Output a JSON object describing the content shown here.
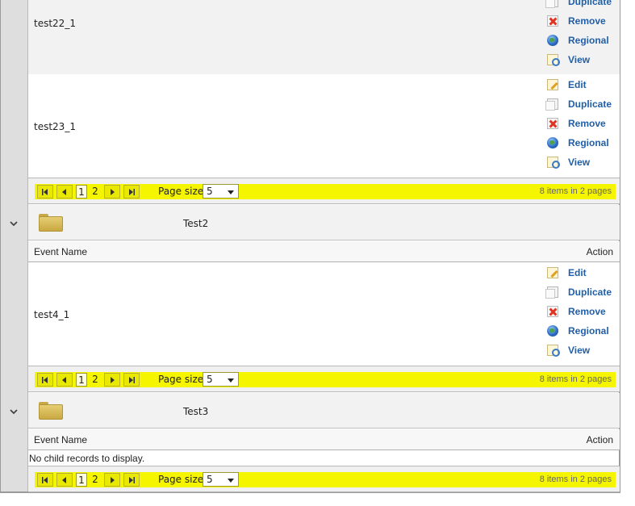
{
  "groups": [
    {
      "rows": [
        {
          "name": "test22_1",
          "actions": [
            "Duplicate",
            "Remove",
            "Regional",
            "View"
          ]
        },
        {
          "name": "test23_1",
          "actions": [
            "Edit",
            "Duplicate",
            "Remove",
            "Regional",
            "View"
          ]
        }
      ],
      "pager": {
        "pages": [
          "1",
          "2"
        ],
        "current": "1",
        "page_size_label": "Page size:",
        "page_size": "5",
        "info": "8 items in 2 pages"
      }
    },
    {
      "name": "Test2",
      "columns": {
        "event_name": "Event Name",
        "action": "Action"
      },
      "rows": [
        {
          "name": "test4_1",
          "actions": [
            "Edit",
            "Duplicate",
            "Remove",
            "Regional",
            "View"
          ]
        }
      ],
      "pager": {
        "pages": [
          "1",
          "2"
        ],
        "current": "1",
        "page_size_label": "Page size:",
        "page_size": "5",
        "info": "8 items in 2 pages"
      }
    },
    {
      "name": "Test3",
      "columns": {
        "event_name": "Event Name",
        "action": "Action"
      },
      "empty_message": "No child records to display.",
      "pager": {
        "pages": [
          "1",
          "2"
        ],
        "current": "1",
        "page_size_label": "Page size:",
        "page_size": "5",
        "info": "8 items in 2 pages"
      }
    }
  ],
  "colors": {
    "link": "#1f5fa9",
    "pager_highlight": "#f5f500"
  }
}
